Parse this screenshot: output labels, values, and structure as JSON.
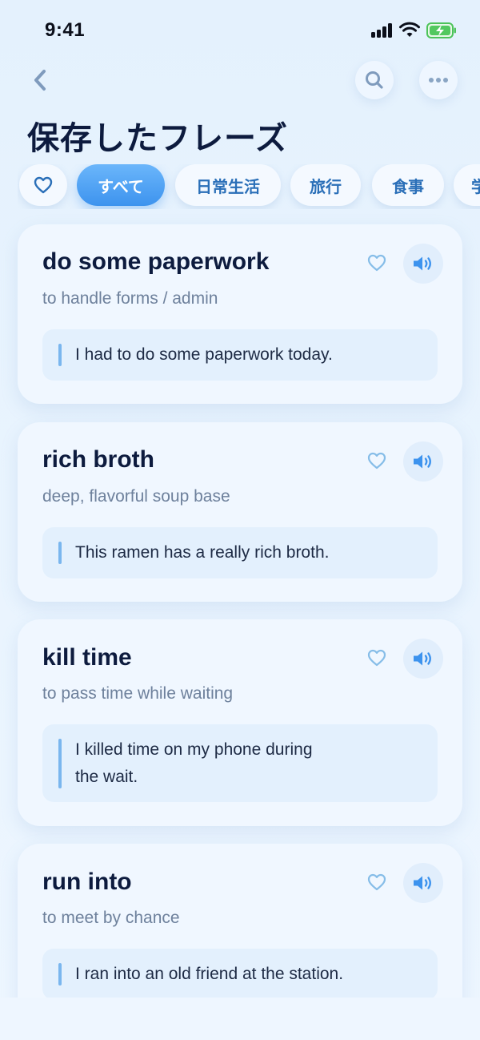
{
  "status_bar": {
    "time": "9:41"
  },
  "header": {
    "title": "保存したフレーズ"
  },
  "icons": {
    "back": "chevron-left-icon",
    "search": "search-icon",
    "more": "more-horizontal-icon",
    "favorite": "heart-outline-icon",
    "audio": "speaker-icon"
  },
  "colors": {
    "accent": "#3d93ee",
    "title": "#0d1b3e",
    "muted": "#6e819c",
    "example_bar": "#7ab6ee"
  },
  "filters": {
    "favorites_icon": "heart-icon",
    "chips": [
      {
        "label": "すべて",
        "active": true
      },
      {
        "label": "日常生活",
        "active": false
      },
      {
        "label": "旅行",
        "active": false
      },
      {
        "label": "食事",
        "active": false
      },
      {
        "label": "学",
        "active": false
      }
    ]
  },
  "phrases": [
    {
      "phrase": "do some paperwork",
      "meaning": "to handle forms / admin",
      "example": "I had to do some paperwork today."
    },
    {
      "phrase": "rich broth",
      "meaning": "deep, flavorful soup base",
      "example": "This ramen has a really rich broth."
    },
    {
      "phrase": "kill time",
      "meaning": "to pass time while waiting",
      "example_lines": [
        "I killed time on my phone during",
        "the wait."
      ]
    },
    {
      "phrase": "run into",
      "meaning": "to meet by chance",
      "example": "I ran into an old friend at the station."
    }
  ]
}
